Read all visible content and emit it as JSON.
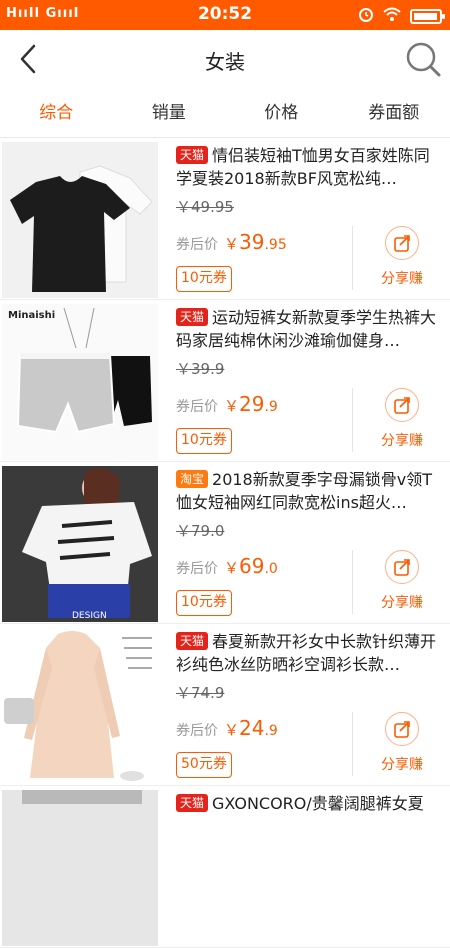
{
  "status_bar": {
    "carrier": "HııIl GıııI",
    "time": "20:52",
    "battery_level": 0.95
  },
  "nav": {
    "title": "女装"
  },
  "tabs": [
    "综合",
    "销量",
    "价格",
    "券面额"
  ],
  "colors": {
    "accent": "#ff5a00",
    "tmall": "#e4231a",
    "taobao": "#ff7b12"
  },
  "labels": {
    "after_coupon": "券后价",
    "share": "分享赚",
    "yen": "￥"
  },
  "products": [
    {
      "platform": "天猫",
      "title": "情侣装短袖T恤男女百家姓陈同学夏装2018新款BF风宽松纯…",
      "old_price": "￥49.95",
      "price_int": "39",
      "price_dec": ".95",
      "coupon": "10元券",
      "image": "tshirts-black-white"
    },
    {
      "platform": "天猫",
      "title": "运动短裤女新款夏季学生热裤大码家居纯棉休闲沙滩瑜伽健身…",
      "old_price": "￥39.9",
      "price_int": "29",
      "price_dec": ".9",
      "coupon": "10元券",
      "image": "grey-shorts",
      "image_text": "Minaishi"
    },
    {
      "platform": "淘宝",
      "title": "2018新款夏季字母漏锁骨v领T恤女短袖网红同款宽松ins超火…",
      "old_price": "￥79.0",
      "price_int": "69",
      "price_dec": ".0",
      "coupon": "10元券",
      "image": "white-tee-model",
      "image_text": "DESIGN"
    },
    {
      "platform": "天猫",
      "title": "春夏新款开衫女中长款针织薄开衫纯色冰丝防晒衫空调衫长款…",
      "old_price": "￥74.9",
      "price_int": "24",
      "price_dec": ".9",
      "coupon": "50元券",
      "image": "cardigan"
    },
    {
      "platform": "天猫",
      "title": "GXONCORO/贵馨阔腿裤女夏",
      "old_price": "",
      "price_int": "",
      "price_dec": "",
      "coupon": "",
      "image": "partial"
    }
  ]
}
